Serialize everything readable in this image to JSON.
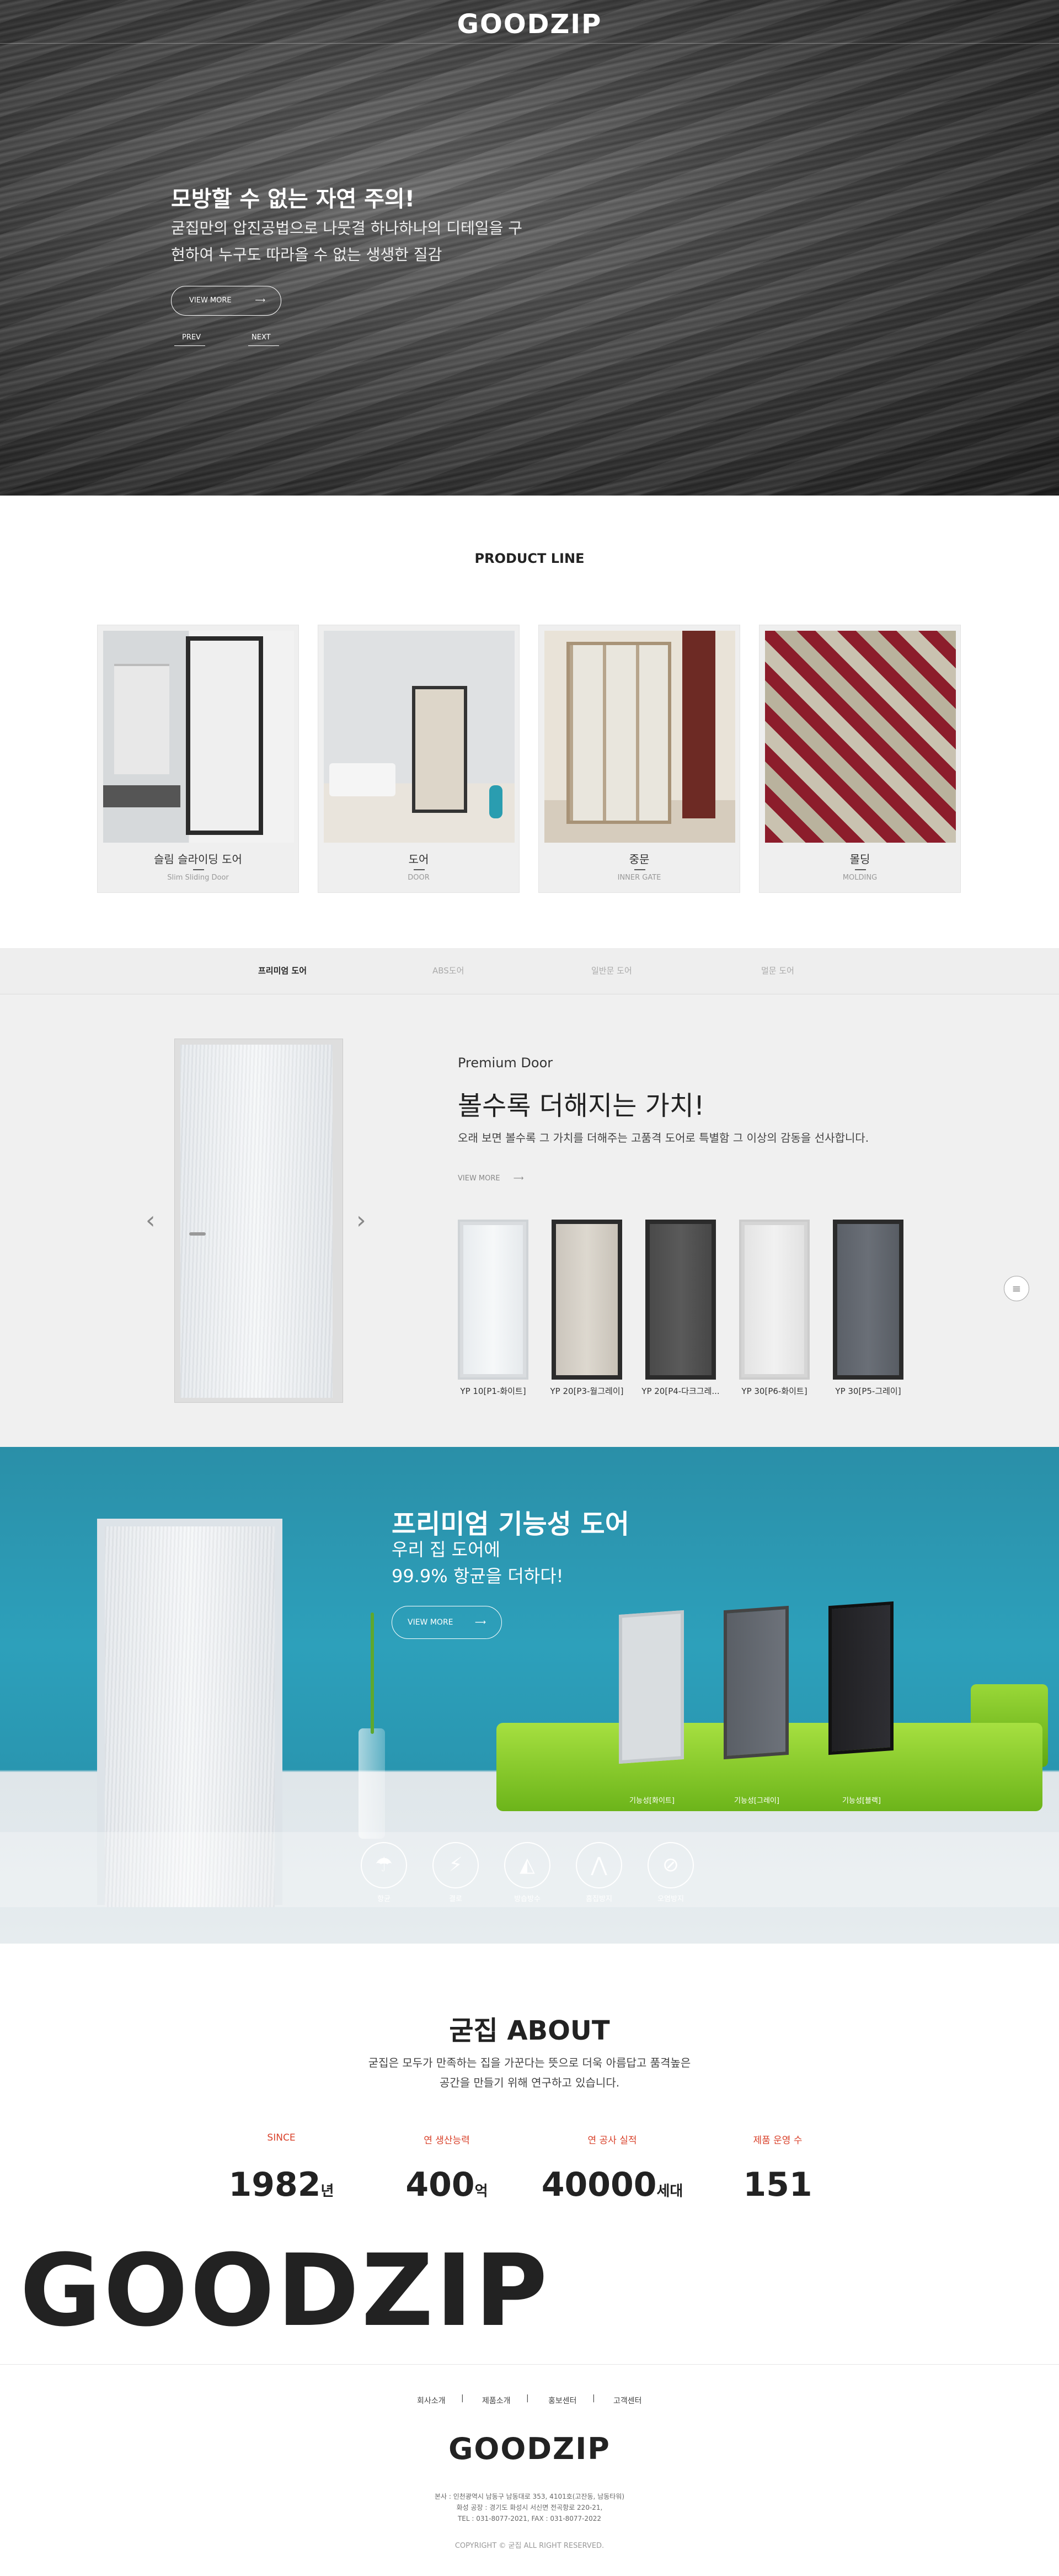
{
  "brand": {
    "logo": "GOODZIP"
  },
  "hero": {
    "title": "모방할 수 없는 자연 주의!",
    "desc_line1": "굳집만의 압진공법으로 나뭇결 하나하나의 디테일을 구",
    "desc_line2": "현하여 누구도 따라올 수 없는 생생한 질감",
    "button": "VIEW MORE",
    "prev": "PREV",
    "next": "NEXT"
  },
  "product_line": {
    "title": "PRODUCT LINE",
    "items": [
      {
        "name": "슬림 슬라이딩 도어",
        "sub": "Slim Sliding Door"
      },
      {
        "name": "도어",
        "sub": "DOOR"
      },
      {
        "name": "중문",
        "sub": "INNER GATE"
      },
      {
        "name": "몰딩",
        "sub": "MOLDING"
      }
    ]
  },
  "tabs": [
    {
      "label": "프리미엄 도어"
    },
    {
      "label": "ABS도어"
    },
    {
      "label": "일반문 도어"
    },
    {
      "label": "멀문 도어"
    }
  ],
  "premium": {
    "label": "Premium Door",
    "title": "볼수록 더해지는 가치!",
    "desc": "오래 보면 볼수록 그 가치를 더해주는 고품격 도어로 특별함 그 이상의 감동을 선사합니다.",
    "more": "VIEW MORE",
    "thumbs": [
      {
        "label": "YP 10[P1-화이트]"
      },
      {
        "label": "YP 20[P3-월그레이]"
      },
      {
        "label": "YP 20[P4-다크그레..."
      },
      {
        "label": "YP 30[P6-화이트]"
      },
      {
        "label": "YP 30[P5-그레이]"
      }
    ]
  },
  "functional": {
    "title": "프리미엄 기능성 도어",
    "sub_line1": "우리 집 도어에",
    "sub_line2": "99.9% 항균을 더하다!",
    "button": "VIEW MORE",
    "doors": [
      {
        "label": "기능성[화이트]"
      },
      {
        "label": "기능성[그레이]"
      },
      {
        "label": "기능성[블랙]"
      }
    ],
    "features": [
      {
        "label": "항균",
        "icon": "antibacterial-icon"
      },
      {
        "label": "결로",
        "icon": "condensation-icon"
      },
      {
        "label": "방습방수",
        "icon": "waterproof-icon"
      },
      {
        "label": "흠집방지",
        "icon": "scratch-icon"
      },
      {
        "label": "오염방지",
        "icon": "stain-icon"
      }
    ]
  },
  "about": {
    "title": "굳집 ABOUT",
    "desc_line1": "굳집은 모두가 만족하는 집을 가꾼다는 뜻으로 더욱 아름답고 품격높은",
    "desc_line2": "공간을 만들기 위해 연구하고 있습니다.",
    "stats": [
      {
        "label": "SINCE",
        "value": "1982",
        "unit": "년"
      },
      {
        "label": "연 생산능력",
        "value": "400",
        "unit": "억"
      },
      {
        "label": "연 공사 실적",
        "value": "40000",
        "unit": "세대"
      },
      {
        "label": "제품 운영 수",
        "value": "151",
        "unit": ""
      }
    ]
  },
  "footer": {
    "nav": [
      "회사소개",
      "제품소개",
      "홍보센터",
      "고객센터"
    ],
    "sep": "|",
    "addr1": "본사 : 인천광역시 남동구 남동대로 353, 4101호(고잔동, 남동타워)",
    "addr2": "화성 공장 : 경기도 화성시 서신면 전곡항로 220-21,",
    "addr3": "TEL : 031-8077-2021, FAX : 031-8077-2022",
    "copyright": "COPYRIGHT © 굳집 ALL RIGHT RESERVED."
  },
  "colors": {
    "accent": "#d9412a",
    "teal": "#2da0bb",
    "green": "#8ccc2c"
  }
}
